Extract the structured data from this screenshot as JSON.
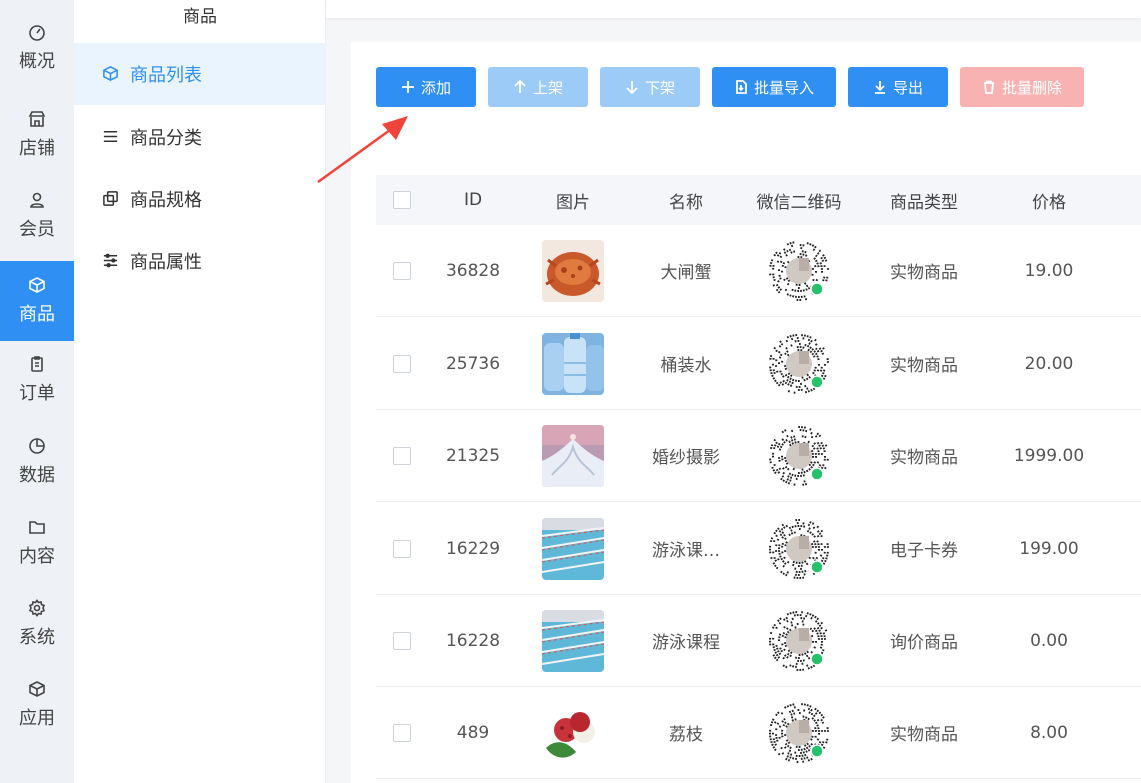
{
  "rail": [
    {
      "label": "概况",
      "icon": "dashboard-icon"
    },
    {
      "label": "店铺",
      "icon": "store-icon"
    },
    {
      "label": "会员",
      "icon": "user-icon"
    },
    {
      "label": "商品",
      "icon": "box-icon",
      "active": true
    },
    {
      "label": "订单",
      "icon": "clipboard-icon"
    },
    {
      "label": "数据",
      "icon": "pie-chart-icon"
    },
    {
      "label": "内容",
      "icon": "folder-icon"
    },
    {
      "label": "系统",
      "icon": "gear-icon"
    },
    {
      "label": "应用",
      "icon": "cube-icon"
    }
  ],
  "sub": {
    "title": "商品",
    "items": [
      {
        "label": "商品列表",
        "icon": "box-icon",
        "active": true
      },
      {
        "label": "商品分类",
        "icon": "list-icon"
      },
      {
        "label": "商品规格",
        "icon": "copy-icon"
      },
      {
        "label": "商品属性",
        "icon": "sliders-icon"
      }
    ]
  },
  "toolbar": {
    "add": "添加",
    "on_shelf": "上架",
    "off_shelf": "下架",
    "batch_import": "批量导入",
    "export": "导出",
    "batch_delete": "批量删除"
  },
  "table": {
    "headers": {
      "id": "ID",
      "image": "图片",
      "name": "名称",
      "qr": "微信二维码",
      "type": "商品类型",
      "price": "价格"
    },
    "rows": [
      {
        "id": "36828",
        "name": "大闸蟹",
        "type": "实物商品",
        "price": "19.00",
        "image": "crab"
      },
      {
        "id": "25736",
        "name": "桶装水",
        "type": "实物商品",
        "price": "20.00",
        "image": "water"
      },
      {
        "id": "21325",
        "name": "婚纱摄影",
        "type": "实物商品",
        "price": "1999.00",
        "image": "wedding"
      },
      {
        "id": "16229",
        "name": "游泳课…",
        "type": "电子卡券",
        "price": "199.00",
        "image": "pool"
      },
      {
        "id": "16228",
        "name": "游泳课程",
        "type": "询价商品",
        "price": "0.00",
        "image": "pool"
      },
      {
        "id": "489",
        "name": "荔枝",
        "type": "实物商品",
        "price": "8.00",
        "image": "lychee"
      }
    ]
  },
  "colors": {
    "primary": "#2f8ff2",
    "primary_light": "#9dcbf8",
    "danger_light": "#f9b2b2",
    "arrow": "#f0433a"
  }
}
